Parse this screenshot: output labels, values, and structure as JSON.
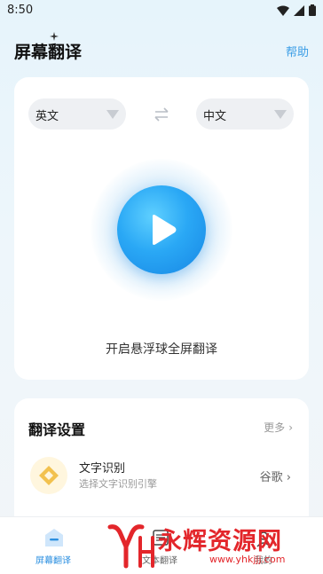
{
  "status_bar": {
    "time": "8:50",
    "icons": [
      "wifi-icon",
      "signal-icon",
      "battery-icon"
    ]
  },
  "header": {
    "title": "屏幕翻译",
    "help": "帮助"
  },
  "translator": {
    "source_language": "英文",
    "target_language": "中文",
    "start_label": "开启悬浮球全屏翻译"
  },
  "settings": {
    "title": "翻译设置",
    "more": "更多",
    "ocr": {
      "title": "文字识别",
      "subtitle": "选择文字识别引擎",
      "value": "谷歌"
    }
  },
  "tabbar": {
    "tabs": [
      {
        "label": "屏幕翻译",
        "active": true
      },
      {
        "label": "文本翻译",
        "active": false
      },
      {
        "label": "我的",
        "active": false
      }
    ]
  },
  "watermark": {
    "name": "永辉资源网",
    "url": "www.yhkjjj.com"
  },
  "colors": {
    "accent": "#2b8fe0",
    "play": "#2aa8f5",
    "watermark": "#e3262b",
    "ocr_icon": "#f2c14e"
  }
}
